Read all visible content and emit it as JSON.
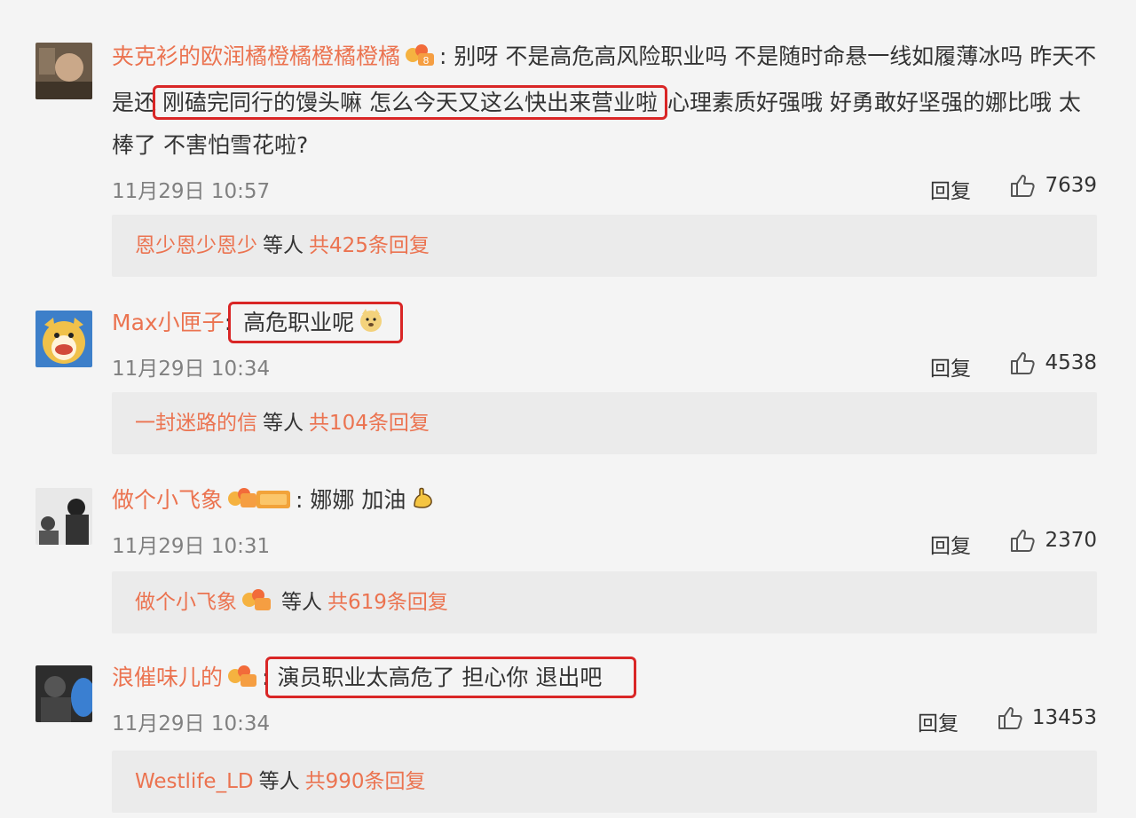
{
  "comments": [
    {
      "username": "夹克衫的欧润橘橙橘橙橘橙橘",
      "colon": ":",
      "text_before": "别呀 不是高危高风险职业吗 不是随时命悬一线如履薄冰吗 昨天不是还",
      "text_highlight": "刚磕完同行的馒头嘛 怎么今天又这么快出来营业啦",
      "text_after": "心理素质好强哦 好勇敢好坚强的娜比哦 太棒了 不害怕雪花啦?",
      "time": "11月29日 10:57",
      "reply_label": "回复",
      "likes": "7639",
      "reply_users": "恩少恩少恩少",
      "reply_mid": "等人",
      "reply_count": "共425条回复"
    },
    {
      "username": "Max小匣子",
      "colon": ":",
      "text_highlight": "高危职业呢",
      "emoji": "doge-icon",
      "time": "11月29日 10:34",
      "reply_label": "回复",
      "likes": "4538",
      "reply_users": "一封迷路的信",
      "reply_mid": "等人",
      "reply_count": "共104条回复"
    },
    {
      "username": "做个小飞象",
      "colon": ":",
      "text": "娜娜 加油",
      "emoji": "muscle-icon",
      "time": "11月29日 10:31",
      "reply_label": "回复",
      "likes": "2370",
      "reply_users": "做个小飞象",
      "reply_mid": "等人",
      "reply_count": "共619条回复"
    },
    {
      "username": "浪催味儿的",
      "colon": ":",
      "text_highlight": "演员职业太高危了 担心你 退出吧",
      "time": "11月29日 10:34",
      "reply_label": "回复",
      "likes": "13453",
      "reply_users": "Westlife_LD",
      "reply_mid": "等人",
      "reply_count": "共990条回复"
    }
  ],
  "colors": {
    "username": "#eb7350",
    "highlight_border": "#d92626",
    "reply_box_bg": "#ebebeb",
    "page_bg": "#f4f4f4"
  }
}
